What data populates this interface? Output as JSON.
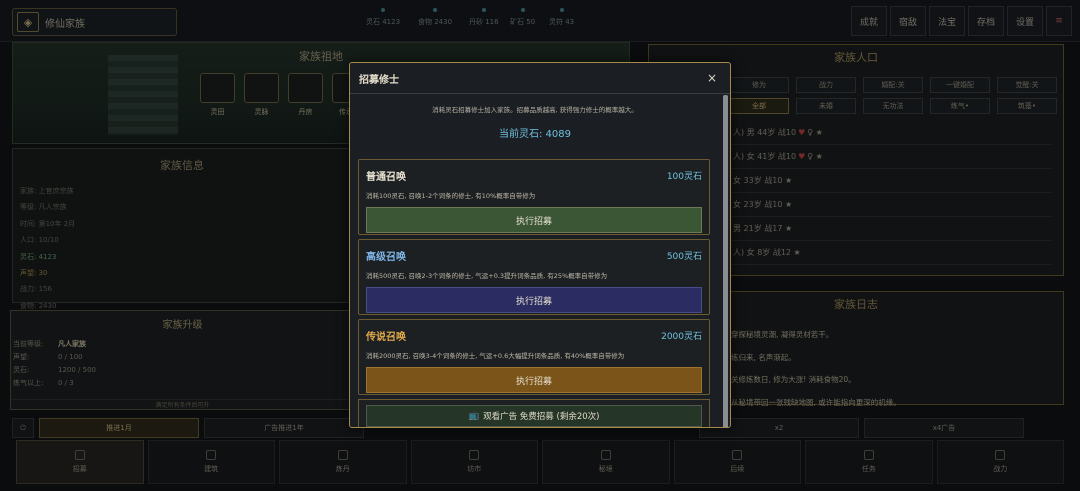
{
  "topbar": {
    "title": "修仙家族",
    "resources": [
      {
        "label": "灵石 4123"
      },
      {
        "label": "食物 2430"
      },
      {
        "label": "丹砂 116"
      },
      {
        "label": "矿石 50"
      },
      {
        "label": "灵符 43"
      }
    ],
    "buttons": [
      "成就",
      "宿敌",
      "法宝",
      "存档",
      "设置"
    ],
    "menu_icon": "≡"
  },
  "scene": {
    "title": "家族祖地",
    "buildings": [
      "灵田",
      "灵脉",
      "丹房",
      "传承阁"
    ]
  },
  "family_info": {
    "title": "家族信息",
    "lines": [
      "家族: 上官庶宗族",
      "等级: 凡人宗族",
      "时间: 第10年 2月",
      "人口: 10/10",
      "灵石: 4123",
      "声望: 30",
      "战力: 156",
      "食物: 2430"
    ]
  },
  "upgrade": {
    "title": "家族升级",
    "rows": [
      {
        "k": "当前等级:",
        "v": "凡人家族"
      },
      {
        "k": "声望:",
        "v": "0 / 100"
      },
      {
        "k": "灵石:",
        "v": "1200 / 500"
      },
      {
        "k": "练气以上:",
        "v": "0 / 3"
      }
    ],
    "requirement": "满足所有条件后可升"
  },
  "population": {
    "title": "家族人口",
    "actions": [
      "修为",
      "战力",
      "婚配:关",
      "一键婚配",
      "觉醒:关"
    ],
    "filters": [
      "全部",
      "未婚",
      "无功法",
      "练气•",
      "筑基•"
    ],
    "members": [
      "人) 男 44岁 战10",
      "人) 女 41岁 战10",
      "女 33岁 战10 ★",
      "女 23岁 战10 ★",
      "男 21岁 战17 ★",
      "人) 女 8岁 战12 ★"
    ]
  },
  "log": {
    "title": "家族日志",
    "entries": [
      "穿探秘境灵潮, 凝得灵材若干。",
      "练归来, 名声渐起。",
      "关修炼数日, 修为大涨! 消耗食物20。",
      "从秘境带回一张残缺地图, 或许能指向更深的机缘。"
    ]
  },
  "speed": {
    "buttons": [
      "推进1月",
      "广告推进1年",
      "x2",
      "x4广告"
    ]
  },
  "nav": {
    "items": [
      "招募",
      "建筑",
      "炼丹",
      "坊市",
      "秘境",
      "后续",
      "任务",
      "战力"
    ]
  },
  "modal": {
    "title": "招募修士",
    "close": "×",
    "description": "消耗灵石招募修士加入家族。招募品质越高, 获得强力修士的概率越大。",
    "current_stone": "当前灵石: 4089",
    "cards": [
      {
        "name": "普通召唤",
        "cost": "100灵石",
        "desc": "消耗100灵石, 召唤1-2个词条的修士, 有10%概率自带修为",
        "button": "执行招募"
      },
      {
        "name": "高级召唤",
        "cost": "500灵石",
        "desc": "消耗500灵石, 召唤2-3个词条的修士, 气运+0.3提升词条品质, 有25%概率自带修为",
        "button": "执行招募"
      },
      {
        "name": "传说召唤",
        "cost": "2000灵石",
        "desc": "消耗2000灵石, 召唤3-4个词条的修士, 气运+0.6大幅提升词条品质, 有40%概率自带修为",
        "button": "执行招募"
      }
    ],
    "ad_button": "观看广告 免费招募 (剩余20次)",
    "tv_icon": "📺"
  }
}
